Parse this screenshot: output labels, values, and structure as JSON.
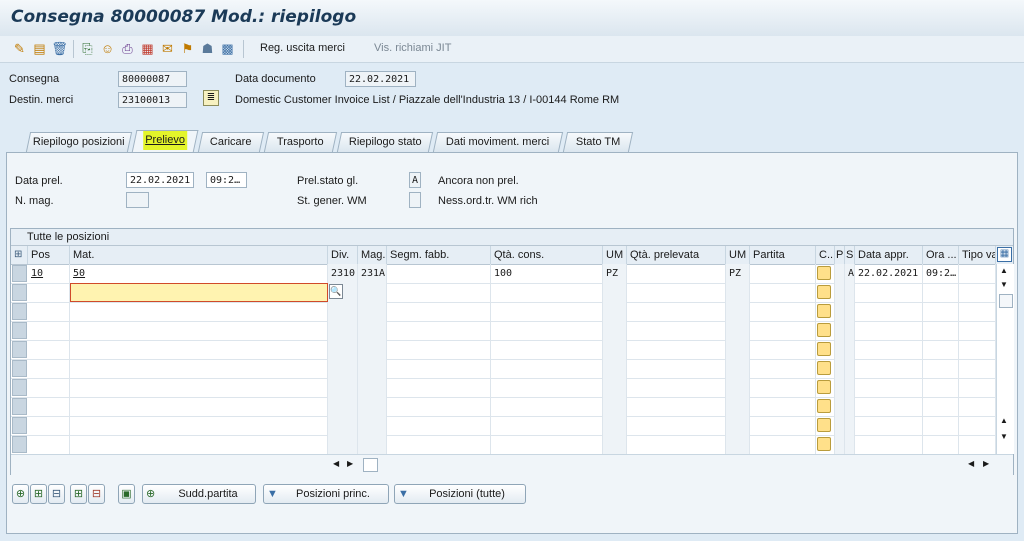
{
  "window": {
    "title": "Consegna 80000087 Mod.: riepilogo"
  },
  "toolbar": {
    "gr_button": "Reg. uscita merci",
    "jit_button": "Vis. richiami JIT"
  },
  "header": {
    "consegna_label": "Consegna",
    "consegna_value": "80000087",
    "data_doc_label": "Data documento",
    "data_doc_value": "22.02.2021",
    "destin_label": "Destin. merci",
    "destin_value": "23100013",
    "destin_desc": "Domestic Customer Invoice List / Piazzale dell'Industria 13 / I-00144 Rome RM"
  },
  "tabs": [
    {
      "label": "Riepilogo posizioni"
    },
    {
      "label": "Prelievo"
    },
    {
      "label": "Caricare"
    },
    {
      "label": "Trasporto"
    },
    {
      "label": "Riepilogo stato"
    },
    {
      "label": "Dati moviment. merci"
    },
    {
      "label": "Stato TM"
    }
  ],
  "picking": {
    "data_prel_label": "Data prel.",
    "data_prel_value": "22.02.2021",
    "ora_prel_value": "09:2…",
    "n_mag_label": "N. mag.",
    "n_mag_value": "",
    "prel_stato_label": "Prel.stato gl.",
    "prel_stato_value": "A",
    "prel_stato_desc": "Ancora non prel.",
    "st_gener_label": "St. gener. WM",
    "st_gener_value": "",
    "st_gener_desc": "Ness.ord.tr. WM rich"
  },
  "grid": {
    "title": "Tutte le posizioni",
    "columns": [
      "Pos",
      "Mat.",
      "Div.",
      "Mag.",
      "Segm. fabb.",
      "Qtà. cons.",
      "UM",
      "Qtà. prelevata",
      "UM",
      "Partita",
      "C..",
      "P",
      "S",
      "Data appr.",
      "Ora ...",
      "Tipo va"
    ],
    "rows": [
      {
        "pos": "10",
        "mat": "50",
        "div": "2310",
        "mag": "231A",
        "segm": "",
        "qta_cons": "100",
        "um": "PZ",
        "qta_prel": "",
        "um2": "PZ",
        "partita": "",
        "p": "",
        "s": "A",
        "data_appr": "22.02.2021",
        "ora": "09:2…",
        "tipo": ""
      }
    ],
    "input_value": ""
  },
  "buttons": {
    "sudd_partita": "Sudd.partita",
    "posizioni_princ": "Posizioni princ.",
    "posizioni_tutte": "Posizioni (tutte)"
  },
  "colors": {
    "highlight": "#e3f52a",
    "checkbox": "#ffe08a",
    "input_active": "#fff3b0"
  }
}
